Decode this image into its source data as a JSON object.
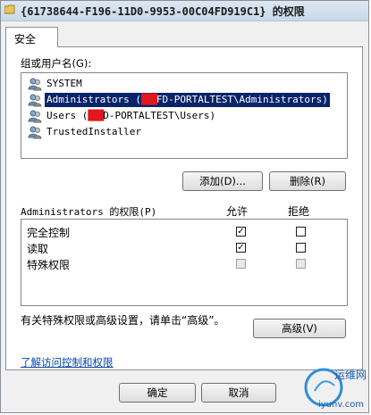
{
  "window": {
    "title": "{61738644-F196-11D0-9953-00C04FD919C1} 的权限"
  },
  "tabs": [
    {
      "label": "安全"
    }
  ],
  "users": {
    "label": "组或用户名(G):",
    "items": [
      {
        "name": "SYSTEM",
        "redacted": "",
        "suffix": ""
      },
      {
        "name": "Administrators (",
        "redacted": "███",
        "suffix": "FD-PORTALTEST\\Administrators)"
      },
      {
        "name": "Users (",
        "redacted": "███",
        "suffix": "D-PORTALTEST\\Users)"
      },
      {
        "name": "TrustedInstaller",
        "redacted": "",
        "suffix": ""
      }
    ],
    "selected_index": 1
  },
  "buttons": {
    "add": "添加(D)...",
    "remove": "删除(R)",
    "advanced": "高级(V)",
    "ok": "确定",
    "cancel": "取消"
  },
  "permissions": {
    "label": "Administrators 的权限(P)",
    "col_allow": "允许",
    "col_deny": "拒绝",
    "rows": [
      {
        "name": "完全控制",
        "allow": true,
        "deny": false,
        "disabled": false
      },
      {
        "name": "读取",
        "allow": true,
        "deny": false,
        "disabled": false
      },
      {
        "name": "特殊权限",
        "allow": false,
        "deny": false,
        "disabled": true
      }
    ]
  },
  "advanced_hint": "有关特殊权限或高级设置，请单击“高级”。",
  "help_link": "了解访问控制和权限",
  "watermark": {
    "line1": "运维网",
    "line2": "iyunv.com"
  },
  "colors": {
    "selection": "#0a246a",
    "link": "#0645ad",
    "redaction": "#e0181e"
  }
}
